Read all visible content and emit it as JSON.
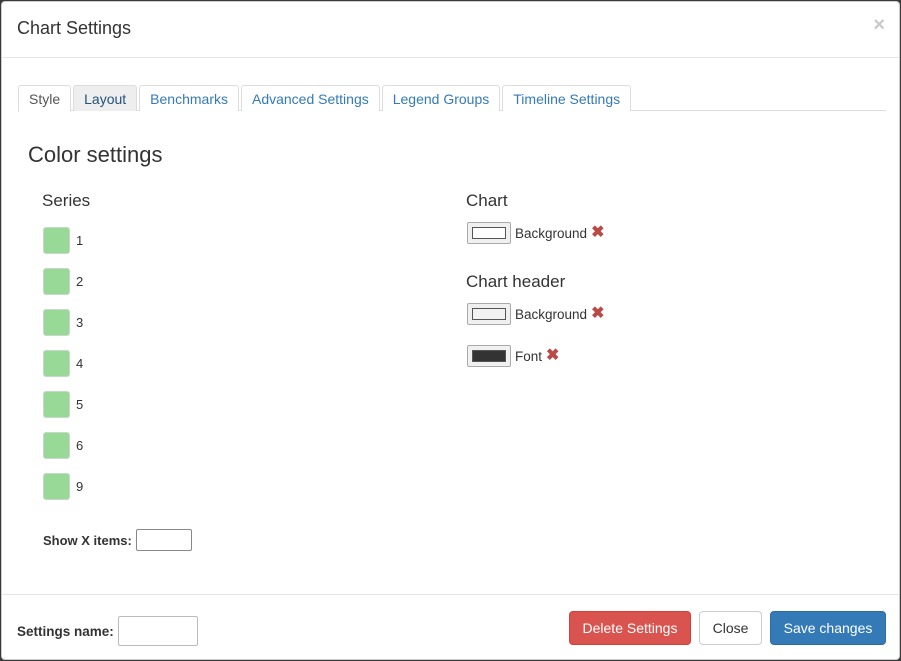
{
  "modal": {
    "title": "Chart Settings",
    "close_glyph": "×"
  },
  "tabs": [
    {
      "label": "Style",
      "active": true
    },
    {
      "label": "Layout"
    },
    {
      "label": "Benchmarks"
    },
    {
      "label": "Advanced Settings"
    },
    {
      "label": "Legend Groups"
    },
    {
      "label": "Timeline Settings"
    }
  ],
  "color_settings": {
    "title": "Color settings",
    "series": {
      "heading": "Series",
      "swatch_color": "#98d997",
      "items": [
        "1",
        "2",
        "3",
        "4",
        "5",
        "6",
        "9"
      ]
    },
    "chart": {
      "heading": "Chart",
      "background_label": "Background",
      "background_color": "#ffffff"
    },
    "chart_header": {
      "heading": "Chart header",
      "background_label": "Background",
      "background_color": "#f2f2f2",
      "font_label": "Font",
      "font_color": "#333333"
    },
    "remove_glyph": "✖"
  },
  "show_x_items": {
    "label": "Show X items:",
    "value": ""
  },
  "footer": {
    "settings_name_label": "Settings name:",
    "settings_name_value": "",
    "delete_label": "Delete Settings",
    "close_label": "Close",
    "save_label": "Save changes"
  }
}
